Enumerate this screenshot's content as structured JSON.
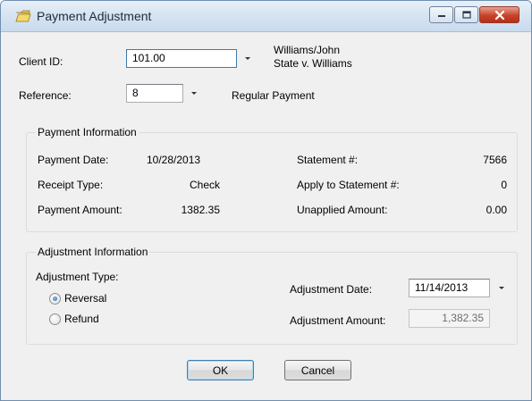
{
  "window": {
    "title": "Payment Adjustment"
  },
  "client": {
    "label": "Client ID:",
    "value": "101.00",
    "name": "Williams/John",
    "case": "State v. Williams"
  },
  "reference": {
    "label": "Reference:",
    "value": "8",
    "description": "Regular Payment"
  },
  "payment_info": {
    "title": "Payment Information",
    "payment_date_label": "Payment Date:",
    "payment_date": "10/28/2013",
    "receipt_type_label": "Receipt Type:",
    "receipt_type": "Check",
    "payment_amount_label": "Payment Amount:",
    "payment_amount": "1382.35",
    "statement_label": "Statement #:",
    "statement": "7566",
    "apply_statement_label": "Apply to Statement #:",
    "apply_statement": "0",
    "unapplied_label": "Unapplied Amount:",
    "unapplied": "0.00"
  },
  "adjustment_info": {
    "title": "Adjustment Information",
    "type_label": "Adjustment Type:",
    "options": [
      "Reversal",
      "Refund"
    ],
    "selected": "Reversal",
    "date_label": "Adjustment Date:",
    "date": "11/14/2013",
    "amount_label": "Adjustment Amount:",
    "amount": "1,382.35"
  },
  "buttons": {
    "ok": "OK",
    "cancel": "Cancel"
  }
}
